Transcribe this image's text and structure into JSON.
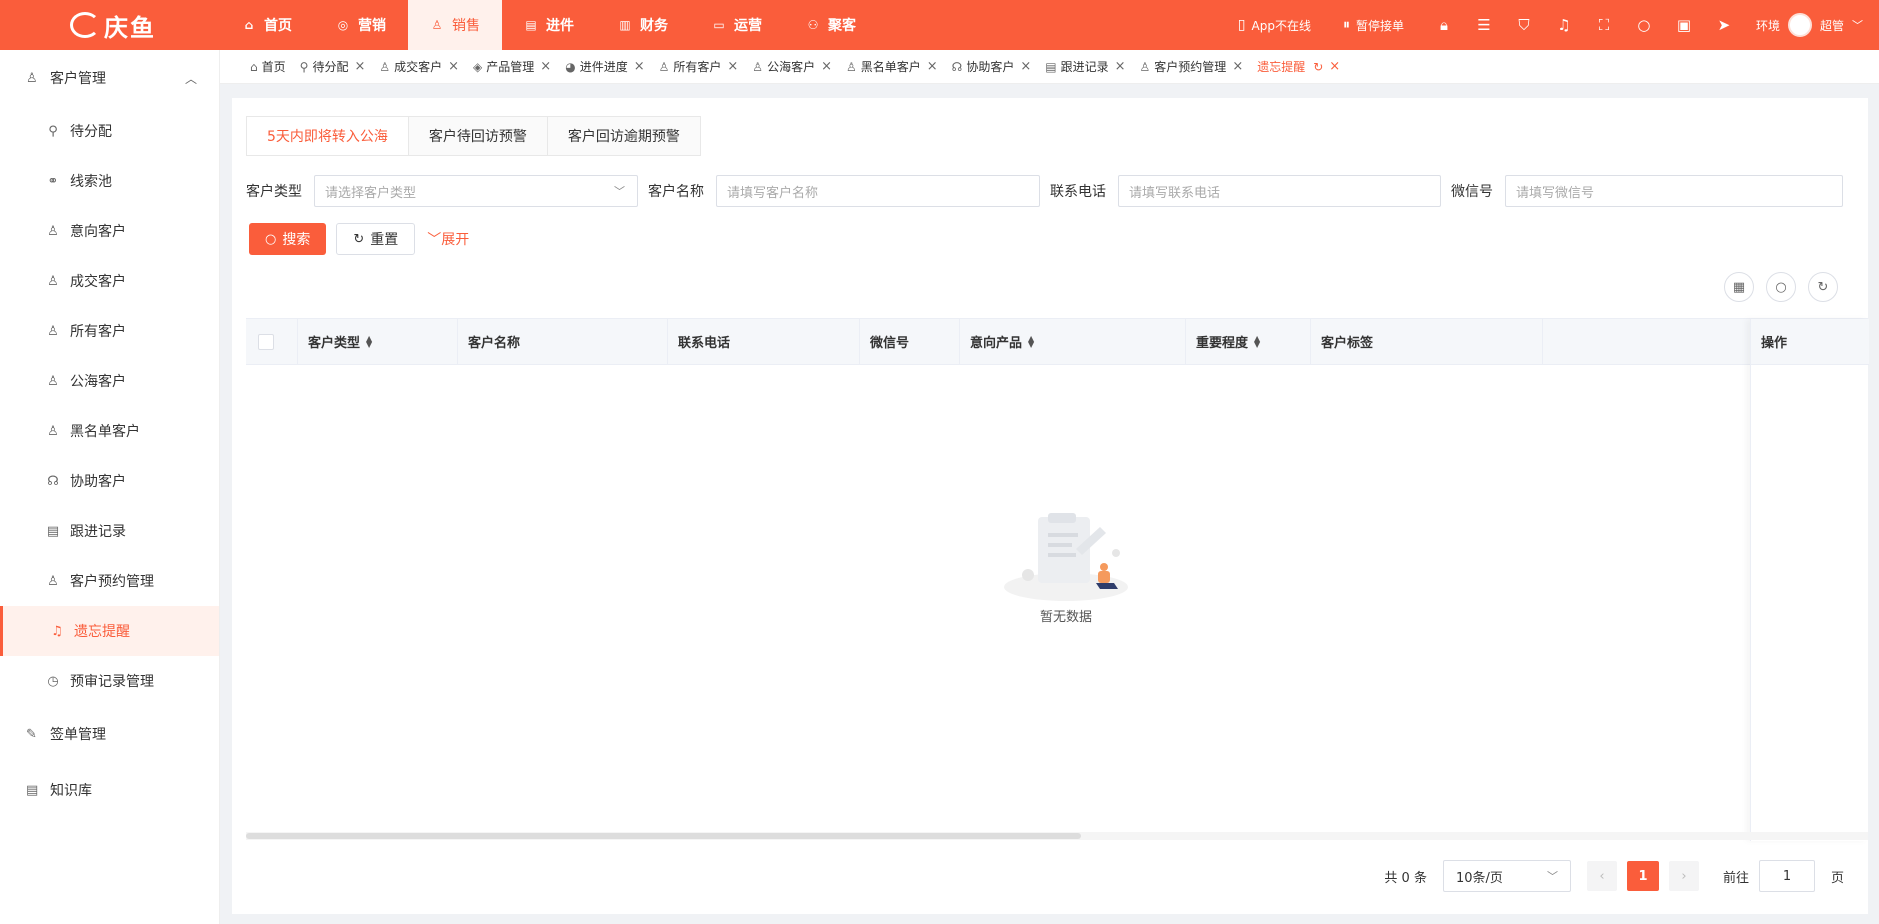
{
  "brand": {
    "logo_text": "庆鱼",
    "accent_color": "#fa5d3b"
  },
  "top_nav": [
    {
      "label": "首页",
      "icon": "home-icon",
      "glyph": "⌂"
    },
    {
      "label": "营销",
      "icon": "marketing-icon",
      "glyph": "◎"
    },
    {
      "label": "销售",
      "icon": "sales-icon",
      "glyph": "♙"
    },
    {
      "label": "进件",
      "icon": "document-icon",
      "glyph": "▤"
    },
    {
      "label": "财务",
      "icon": "finance-icon",
      "glyph": "▥"
    },
    {
      "label": "运营",
      "icon": "operations-icon",
      "glyph": "▭"
    },
    {
      "label": "聚客",
      "icon": "group-icon",
      "glyph": "⚇"
    }
  ],
  "top_right": {
    "app_status": "App不在线",
    "pause_orders": "暂停接单",
    "env_label": "环境",
    "user_name": "超管"
  },
  "sidebar": {
    "group_customer": "客户管理",
    "items": [
      {
        "label": "待分配",
        "icon": "hierarchy-icon",
        "glyph": "⚲"
      },
      {
        "label": "线索池",
        "icon": "clue-icon",
        "glyph": "⚭"
      },
      {
        "label": "意向客户",
        "icon": "user-icon",
        "glyph": "♙"
      },
      {
        "label": "成交客户",
        "icon": "deal-user-icon",
        "glyph": "♙"
      },
      {
        "label": "所有客户",
        "icon": "users-icon",
        "glyph": "♙"
      },
      {
        "label": "公海客户",
        "icon": "public-user-icon",
        "glyph": "♙"
      },
      {
        "label": "黑名单客户",
        "icon": "blacklist-user-icon",
        "glyph": "♙"
      },
      {
        "label": "协助客户",
        "icon": "assist-user-icon",
        "glyph": "☊"
      },
      {
        "label": "跟进记录",
        "icon": "record-icon",
        "glyph": "▤"
      },
      {
        "label": "客户预约管理",
        "icon": "appointment-icon",
        "glyph": "♙"
      },
      {
        "label": "遗忘提醒",
        "icon": "bell-icon",
        "glyph": "♫"
      },
      {
        "label": "预审记录管理",
        "icon": "clock-icon",
        "glyph": "◷"
      }
    ],
    "group_sign": "签单管理",
    "group_knowledge": "知识库"
  },
  "tabs": [
    {
      "label": "首页",
      "glyph": "⌂",
      "closable": false
    },
    {
      "label": "待分配",
      "glyph": "⚲",
      "closable": true
    },
    {
      "label": "成交客户",
      "glyph": "♙",
      "closable": true
    },
    {
      "label": "产品管理",
      "glyph": "◈",
      "closable": true
    },
    {
      "label": "进件进度",
      "glyph": "◕",
      "closable": true
    },
    {
      "label": "所有客户",
      "glyph": "♙",
      "closable": true
    },
    {
      "label": "公海客户",
      "glyph": "♙",
      "closable": true
    },
    {
      "label": "黑名单客户",
      "glyph": "♙",
      "closable": true
    },
    {
      "label": "协助客户",
      "glyph": "☊",
      "closable": true
    },
    {
      "label": "跟进记录",
      "glyph": "▤",
      "closable": true
    },
    {
      "label": "客户预约管理",
      "glyph": "♙",
      "closable": true
    },
    {
      "label": "遗忘提醒",
      "glyph": "",
      "closable": true
    }
  ],
  "subtabs": [
    "5天内即将转入公海",
    "客户待回访预警",
    "客户回访逾期预警"
  ],
  "filters": {
    "customer_type_label": "客户类型",
    "customer_type_placeholder": "请选择客户类型",
    "customer_name_label": "客户名称",
    "customer_name_placeholder": "请填写客户名称",
    "phone_label": "联系电话",
    "phone_placeholder": "请填写联系电话",
    "wechat_label": "微信号",
    "wechat_placeholder": "请填写微信号"
  },
  "buttons": {
    "search": "搜索",
    "reset": "重置",
    "expand": "展开"
  },
  "table": {
    "columns": [
      "客户类型",
      "客户名称",
      "联系电话",
      "微信号",
      "意向产品",
      "重要程度",
      "客户标签"
    ],
    "sortable": [
      true,
      false,
      false,
      false,
      true,
      true,
      false
    ],
    "operation_header": "操作",
    "empty_text": "暂无数据"
  },
  "pagination": {
    "total_text": "共 0 条",
    "page_size": "10条/页",
    "current_page": "1",
    "goto_label": "前往",
    "goto_value": "1",
    "page_unit": "页"
  }
}
